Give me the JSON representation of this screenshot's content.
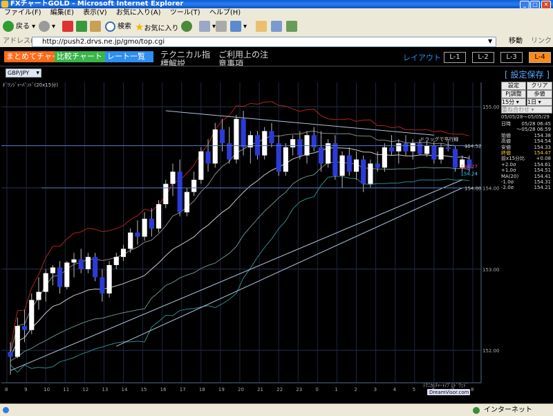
{
  "window": {
    "title": "FXチャートGOLD - Microsoft Internet Explorer"
  },
  "menu": [
    "ファイル(F)",
    "編集(E)",
    "表示(V)",
    "お気に入り(A)",
    "ツール(T)",
    "ヘルプ(H)"
  ],
  "toolbar": {
    "back": "戻る",
    "search": "検索",
    "favorites": "お気に入り"
  },
  "address": {
    "label": "アドレス(D)",
    "url": "http://push2.drvs.ne.jp/gmo/top.cgi",
    "go": "移動",
    "links": "リンク"
  },
  "nav": {
    "matome": "まとめてチャート",
    "hikaku": "比較チャート",
    "rate": "レート一覧",
    "technical": "テクニカル指標解説",
    "riyou": "ご利用上の注意事項"
  },
  "layout": {
    "label": "レイアウト",
    "buttons": [
      "L-1",
      "L-2",
      "L-3",
      "L-4"
    ]
  },
  "currency": "GBP/JPY",
  "save_label": "[ 設定保存 ]",
  "chart": {
    "indicator_label": "ﾎﾞﾘﾝｼﾞｬｰﾊﾞﾝﾄﾞ(20x15分)",
    "drag_hint": "ドラッグで平行線",
    "marker_price": "154.52",
    "last_red": "154.27",
    "last_cyan": "154.24",
    "line_price": "154.00",
    "watermark_line1": "ﾃｸﾆｶﾙﾁｬｰﾄ/ﾌﾟﾛﾄﾞｳｪﾄﾞ",
    "watermark_brand": "DreamVisor.com"
  },
  "chart_data": {
    "type": "candlestick",
    "y_ticks": [
      "155.00",
      "154.00",
      "153.00",
      "152.00"
    ],
    "x_ticks": [
      "8",
      "9",
      "10",
      "11",
      "12",
      "13",
      "14",
      "15",
      "16",
      "17",
      "18",
      "19",
      "20",
      "21",
      "22",
      "23",
      "0",
      "1",
      "2",
      "3",
      "4",
      "5",
      "6",
      "7",
      "8"
    ],
    "ylim": [
      151.6,
      155.3
    ],
    "candles": [
      {
        "o": 151.98,
        "h": 152.1,
        "l": 151.7,
        "c": 151.92
      },
      {
        "o": 151.92,
        "h": 152.4,
        "l": 151.9,
        "c": 152.3
      },
      {
        "o": 152.3,
        "h": 152.5,
        "l": 152.1,
        "c": 152.25
      },
      {
        "o": 152.25,
        "h": 152.7,
        "l": 152.2,
        "c": 152.62
      },
      {
        "o": 152.62,
        "h": 152.9,
        "l": 152.5,
        "c": 152.72
      },
      {
        "o": 152.72,
        "h": 153.0,
        "l": 152.6,
        "c": 152.95
      },
      {
        "o": 152.95,
        "h": 153.05,
        "l": 152.8,
        "c": 153.02
      },
      {
        "o": 153.02,
        "h": 153.1,
        "l": 152.7,
        "c": 152.78
      },
      {
        "o": 152.78,
        "h": 153.1,
        "l": 152.75,
        "c": 153.08
      },
      {
        "o": 153.08,
        "h": 153.2,
        "l": 152.9,
        "c": 153.12
      },
      {
        "o": 153.12,
        "h": 153.25,
        "l": 152.95,
        "c": 153.0
      },
      {
        "o": 153.0,
        "h": 153.2,
        "l": 152.95,
        "c": 153.15
      },
      {
        "o": 153.15,
        "h": 153.2,
        "l": 152.85,
        "c": 152.9
      },
      {
        "o": 152.9,
        "h": 153.0,
        "l": 152.6,
        "c": 152.7
      },
      {
        "o": 152.7,
        "h": 153.1,
        "l": 152.65,
        "c": 153.05
      },
      {
        "o": 153.05,
        "h": 153.2,
        "l": 153.0,
        "c": 153.15
      },
      {
        "o": 153.15,
        "h": 153.3,
        "l": 153.1,
        "c": 153.25
      },
      {
        "o": 153.25,
        "h": 153.5,
        "l": 153.2,
        "c": 153.45
      },
      {
        "o": 153.45,
        "h": 153.6,
        "l": 153.3,
        "c": 153.4
      },
      {
        "o": 153.4,
        "h": 153.7,
        "l": 153.35,
        "c": 153.62
      },
      {
        "o": 153.62,
        "h": 153.75,
        "l": 153.4,
        "c": 153.5
      },
      {
        "o": 153.5,
        "h": 153.85,
        "l": 153.45,
        "c": 153.8
      },
      {
        "o": 153.8,
        "h": 154.1,
        "l": 153.75,
        "c": 154.05
      },
      {
        "o": 154.05,
        "h": 154.3,
        "l": 153.9,
        "c": 154.2
      },
      {
        "o": 154.2,
        "h": 154.35,
        "l": 153.65,
        "c": 153.7
      },
      {
        "o": 153.7,
        "h": 154.0,
        "l": 153.65,
        "c": 153.95
      },
      {
        "o": 153.95,
        "h": 154.2,
        "l": 153.9,
        "c": 154.1
      },
      {
        "o": 154.1,
        "h": 154.5,
        "l": 154.05,
        "c": 154.45
      },
      {
        "o": 154.45,
        "h": 154.6,
        "l": 154.2,
        "c": 154.3
      },
      {
        "o": 154.3,
        "h": 154.8,
        "l": 154.25,
        "c": 154.72
      },
      {
        "o": 154.72,
        "h": 154.85,
        "l": 154.45,
        "c": 154.55
      },
      {
        "o": 154.55,
        "h": 154.75,
        "l": 154.3,
        "c": 154.35
      },
      {
        "o": 154.35,
        "h": 154.9,
        "l": 154.3,
        "c": 154.85
      },
      {
        "o": 154.85,
        "h": 154.95,
        "l": 154.4,
        "c": 154.5
      },
      {
        "o": 154.5,
        "h": 154.7,
        "l": 154.3,
        "c": 154.65
      },
      {
        "o": 154.65,
        "h": 154.7,
        "l": 154.35,
        "c": 154.4
      },
      {
        "o": 154.4,
        "h": 154.75,
        "l": 154.35,
        "c": 154.7
      },
      {
        "o": 154.7,
        "h": 154.8,
        "l": 154.5,
        "c": 154.55
      },
      {
        "o": 154.55,
        "h": 154.65,
        "l": 154.15,
        "c": 154.2
      },
      {
        "o": 154.2,
        "h": 154.55,
        "l": 154.15,
        "c": 154.5
      },
      {
        "o": 154.5,
        "h": 154.65,
        "l": 154.4,
        "c": 154.6
      },
      {
        "o": 154.6,
        "h": 154.7,
        "l": 154.35,
        "c": 154.4
      },
      {
        "o": 154.4,
        "h": 154.7,
        "l": 154.3,
        "c": 154.65
      },
      {
        "o": 154.65,
        "h": 154.75,
        "l": 154.45,
        "c": 154.5
      },
      {
        "o": 154.5,
        "h": 154.7,
        "l": 154.2,
        "c": 154.3
      },
      {
        "o": 154.3,
        "h": 154.6,
        "l": 154.25,
        "c": 154.55
      },
      {
        "o": 154.55,
        "h": 154.65,
        "l": 154.1,
        "c": 154.15
      },
      {
        "o": 154.15,
        "h": 154.45,
        "l": 154.0,
        "c": 154.4
      },
      {
        "o": 154.4,
        "h": 154.5,
        "l": 154.15,
        "c": 154.2
      },
      {
        "o": 154.2,
        "h": 154.45,
        "l": 154.1,
        "c": 154.35
      },
      {
        "o": 154.35,
        "h": 154.4,
        "l": 153.95,
        "c": 154.05
      },
      {
        "o": 154.05,
        "h": 154.35,
        "l": 154.0,
        "c": 154.3
      },
      {
        "o": 154.3,
        "h": 154.45,
        "l": 154.2,
        "c": 154.25
      },
      {
        "o": 154.25,
        "h": 154.55,
        "l": 154.2,
        "c": 154.5
      },
      {
        "o": 154.5,
        "h": 154.65,
        "l": 154.4,
        "c": 154.45
      },
      {
        "o": 154.45,
        "h": 154.6,
        "l": 154.3,
        "c": 154.55
      },
      {
        "o": 154.55,
        "h": 154.65,
        "l": 154.4,
        "c": 154.45
      },
      {
        "o": 154.45,
        "h": 154.6,
        "l": 154.35,
        "c": 154.55
      },
      {
        "o": 154.55,
        "h": 154.6,
        "l": 154.4,
        "c": 154.42
      },
      {
        "o": 154.42,
        "h": 154.58,
        "l": 154.38,
        "c": 154.52
      },
      {
        "o": 154.52,
        "h": 154.58,
        "l": 154.3,
        "c": 154.35
      },
      {
        "o": 154.35,
        "h": 154.55,
        "l": 154.3,
        "c": 154.5
      },
      {
        "o": 154.5,
        "h": 154.6,
        "l": 154.45,
        "c": 154.48
      },
      {
        "o": 154.48,
        "h": 154.52,
        "l": 154.2,
        "c": 154.25
      },
      {
        "o": 154.25,
        "h": 154.4,
        "l": 154.2,
        "c": 154.35
      },
      {
        "o": 154.35,
        "h": 154.4,
        "l": 154.2,
        "c": 154.24
      }
    ]
  },
  "side": {
    "setting": "設定",
    "clear": "クリア",
    "pl": "P|調整",
    "step": "歩値",
    "tf": "15分",
    "range": "1日",
    "overlay": "重ね合わせ",
    "date_range": "05/05/28～05/05/29",
    "rows": [
      {
        "label": "日時",
        "value": "05/28 06:45"
      },
      {
        "label": "",
        "value": "～05/28 06:59"
      },
      {
        "label": "始値",
        "value": "154.38"
      },
      {
        "label": "高値",
        "value": "154.54"
      },
      {
        "label": "安値",
        "value": "154.33"
      },
      {
        "label": "終値",
        "value": "154.47"
      },
      {
        "label": "前x15分比",
        "value": "+0.08"
      },
      {
        "label": "+2.0σ",
        "value": "154.61"
      },
      {
        "label": "+1.0σ",
        "value": "154.51"
      },
      {
        "label": "MA(20)",
        "value": "154.41"
      },
      {
        "label": "-1.0σ",
        "value": "154.31"
      },
      {
        "label": "-2.0σ",
        "value": "154.21"
      }
    ]
  },
  "status": {
    "zone": "インターネット"
  },
  "colors": {
    "up": "#ffffff",
    "down": "#2b3bd8",
    "grid": "#2b3a55",
    "accent": "#2a8cff"
  }
}
